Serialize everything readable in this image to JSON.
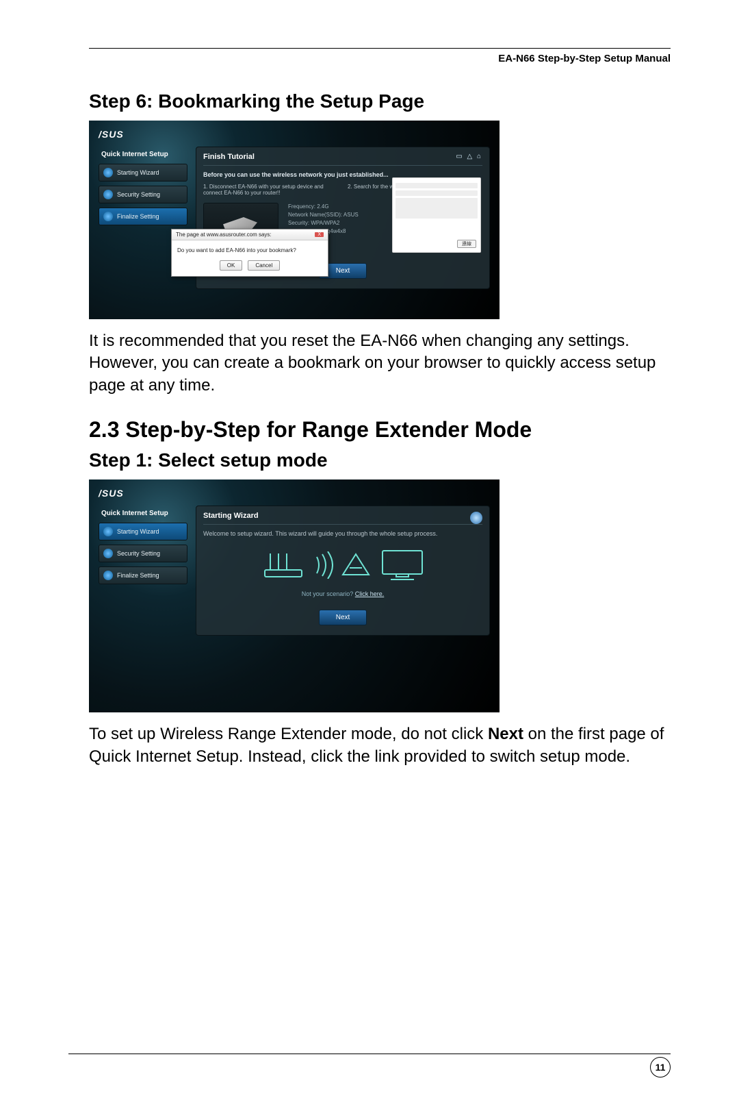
{
  "header": "EA-N66 Step-by-Step Setup Manual",
  "page_number": "11",
  "step6_title": "Step 6:   Bookmarking the Setup Page",
  "step6_body": "It is recommended that you reset the EA-N66 when changing any settings. However, you can create a bookmark on your browser to quickly access setup page at any time.",
  "section_title": "2.3 Step-by-Step for Range Extender Mode",
  "step1_title": "Step 1:   Select setup mode",
  "step1_body_pre": "To set up Wireless Range Extender mode, do not click ",
  "step1_body_bold": "Next",
  "step1_body_post": " on the first page of Quick Internet Setup. Instead, click the link provided to switch setup mode.",
  "shot": {
    "logo": "/SUS",
    "sidebar_head": "Quick Internet Setup",
    "items": [
      "Starting Wizard",
      "Security Setting",
      "Finalize Setting"
    ],
    "s1": {
      "title": "Finish Tutorial",
      "sub": "Before you can use the wireless network you just established...",
      "col1": "1. Disconnect EA-N66 with your setup device and connect EA-N66 to your router!!",
      "col2": "2. Search for the wireless network you just established.",
      "meta1": "Frequency: 2.4G",
      "meta2": "Network Name(SSID): ASUS",
      "meta3": "Security: WPA/WPA2",
      "meta4": "Security key: p3q4w4x8",
      "next": "Next",
      "modal_title": "The page at www.asusrouter.com says:",
      "modal_body": "Do you want to add EA-N66 into your bookmark?",
      "ok": "OK",
      "cancel": "Cancel"
    },
    "s2": {
      "title": "Starting Wizard",
      "sub": "Welcome to setup wizard. This wizard will guide you through the whole setup process.",
      "link_pre": "Not your scenario? ",
      "link": "Click here.",
      "next": "Next"
    }
  }
}
